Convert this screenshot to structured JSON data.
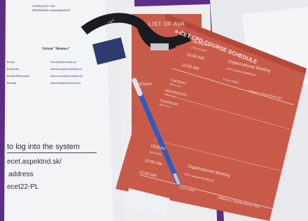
{
  "left_sheet": {
    "code_line": "LOGIN ECET 195",
    "password_line": "PASSWORD: ecetmaster2022",
    "heading": "Virtual \"Mentors\"",
    "names": [
      "Perzyk",
      "Konieczna",
      "Pawlak-Hornowska",
      "Pietrzak"
    ],
    "emails": [
      "iferzyk@ath.bielsko.pl",
      "mkonieczna@ath.bielsko.pl",
      "mhornowska@ath.bielsko.pl",
      "mkrasinski@ath.bielsko.pl"
    ],
    "login_heading": "to log into the system",
    "url": "ecet.aspektnd.sk/",
    "address_label": "address",
    "password": "ecet22-PL"
  },
  "back_sheet": {
    "title": "LIST OF AVA",
    "days": [
      "TUESDAY",
      "WEDNESDAY",
      "THURSDAY"
    ]
  },
  "schedule": {
    "title": "e-CET CPD COURSE SCHEDULE",
    "sections": [
      {
        "day": "MONDAY",
        "date": "27th of June",
        "times": [
          "10:00 AM",
          "12:00 AM"
        ],
        "event": "Organizational Meeting",
        "location": "ATH Campus Building B",
        "join": "To join online:",
        "room": "Willowa 2 Street Room 313"
      },
      {
        "day": "FRIDAY",
        "date": "1st of July",
        "times": [
          "10:00 AM",
          "12:00 AM"
        ],
        "event": "Organizational Meeting",
        "location": "ATH Campus Building B",
        "join": "To join online:",
        "room": "Willowa 2 Street Room 313"
      }
    ],
    "middle_days": [
      {
        "day": "TUESDAY",
        "date": "28th of June"
      },
      {
        "day": "WEDNESDAY",
        "date": "29th of June"
      },
      {
        "day": "THURSDAY",
        "date": "30th of June"
      }
    ]
  },
  "lanyard": {
    "text": "e-CET"
  },
  "pen": {
    "color": "#2f5bbd"
  },
  "colors": {
    "background": "#5b2e87",
    "poster": "#c85a4a",
    "paper": "#f2f3f5",
    "lanyard": "#1b1b22"
  }
}
